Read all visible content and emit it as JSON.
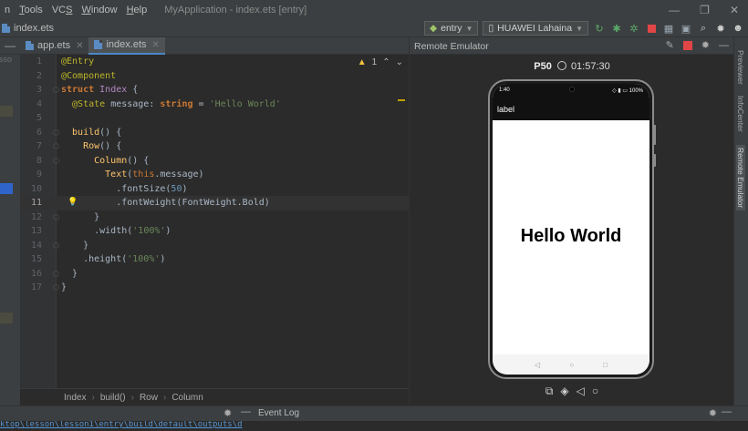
{
  "menubar": {
    "items": [
      {
        "label": "n"
      },
      {
        "mnemonic": "T",
        "rest": "ools"
      },
      {
        "mnemonic": "",
        "rest": "VC",
        "tail": "S"
      },
      {
        "mnemonic": "W",
        "rest": "indow"
      },
      {
        "mnemonic": "H",
        "rest": "elp"
      }
    ],
    "title": "MyApplication - index.ets [entry]",
    "controls": [
      "—",
      "❐",
      "✕"
    ]
  },
  "toolbar": {
    "file_crumb": "index.ets",
    "module_combo": "entry",
    "device_combo": "HUAWEI Lahaina"
  },
  "tabs": [
    {
      "label": "app.ets",
      "active": false
    },
    {
      "label": "index.ets",
      "active": true
    }
  ],
  "editor": {
    "warning_count": "1",
    "current_line": 11,
    "lines": [
      {
        "n": "1",
        "parts": [
          {
            "c": "ann",
            "t": "@Entry"
          }
        ]
      },
      {
        "n": "2",
        "parts": [
          {
            "c": "ann",
            "t": "@Component"
          }
        ]
      },
      {
        "n": "3",
        "parts": [
          {
            "c": "kw",
            "t": "struct "
          },
          {
            "c": "cls",
            "t": "Index "
          },
          {
            "c": "pl",
            "t": "{"
          }
        ]
      },
      {
        "n": "4",
        "parts": [
          {
            "c": "ann",
            "t": "  @State "
          },
          {
            "c": "pl",
            "t": "message: "
          },
          {
            "c": "kw",
            "t": "string "
          },
          {
            "c": "pl",
            "t": "= "
          },
          {
            "c": "str",
            "t": "'Hello World'"
          }
        ]
      },
      {
        "n": "5",
        "parts": []
      },
      {
        "n": "6",
        "parts": [
          {
            "c": "fnc",
            "t": "  build"
          },
          {
            "c": "pl",
            "t": "() {"
          }
        ]
      },
      {
        "n": "7",
        "parts": [
          {
            "c": "fnc",
            "t": "    Row"
          },
          {
            "c": "pl",
            "t": "() {"
          }
        ]
      },
      {
        "n": "8",
        "parts": [
          {
            "c": "fnc",
            "t": "      Column"
          },
          {
            "c": "pl",
            "t": "() {"
          }
        ]
      },
      {
        "n": "9",
        "parts": [
          {
            "c": "fnc",
            "t": "        Text"
          },
          {
            "c": "pl",
            "t": "("
          },
          {
            "c": "this",
            "t": "this"
          },
          {
            "c": "pl",
            "t": ".message)"
          }
        ]
      },
      {
        "n": "10",
        "parts": [
          {
            "c": "pl",
            "t": "          .fontSize("
          },
          {
            "c": "num",
            "t": "50"
          },
          {
            "c": "pl",
            "t": ")"
          }
        ]
      },
      {
        "n": "11",
        "parts": [
          {
            "c": "pl",
            "t": "          .fontWeight(FontWeight.Bold)"
          }
        ]
      },
      {
        "n": "12",
        "parts": [
          {
            "c": "pl",
            "t": "      }"
          }
        ]
      },
      {
        "n": "13",
        "parts": [
          {
            "c": "pl",
            "t": "      .width("
          },
          {
            "c": "str",
            "t": "'100%'"
          },
          {
            "c": "pl",
            "t": ")"
          }
        ]
      },
      {
        "n": "14",
        "parts": [
          {
            "c": "pl",
            "t": "    }"
          }
        ]
      },
      {
        "n": "15",
        "parts": [
          {
            "c": "pl",
            "t": "    .height("
          },
          {
            "c": "str",
            "t": "'100%'"
          },
          {
            "c": "pl",
            "t": ")"
          }
        ]
      },
      {
        "n": "16",
        "parts": [
          {
            "c": "pl",
            "t": "  }"
          }
        ]
      },
      {
        "n": "17",
        "parts": [
          {
            "c": "pl",
            "t": "}"
          }
        ]
      }
    ]
  },
  "breadcrumb": [
    "Index",
    "build()",
    "Row",
    "Column"
  ],
  "bottom": {
    "event_log_label": "Event Log",
    "path_text": "ktop\\lesson\\lesson1\\entry\\build\\default\\outputs\\d"
  },
  "emulator": {
    "panel_title": "Remote Emulator",
    "device_name": "P50",
    "timer": "01:57:30",
    "status_time": "1:40",
    "status_icons": "◇ ▮ ▭ 100%",
    "app_label": "label",
    "hello_text": "Hello World"
  },
  "right_tabs": [
    "Previewer",
    "InfoCenter",
    "Remote Emulator"
  ],
  "left_strip_text": "lesso"
}
